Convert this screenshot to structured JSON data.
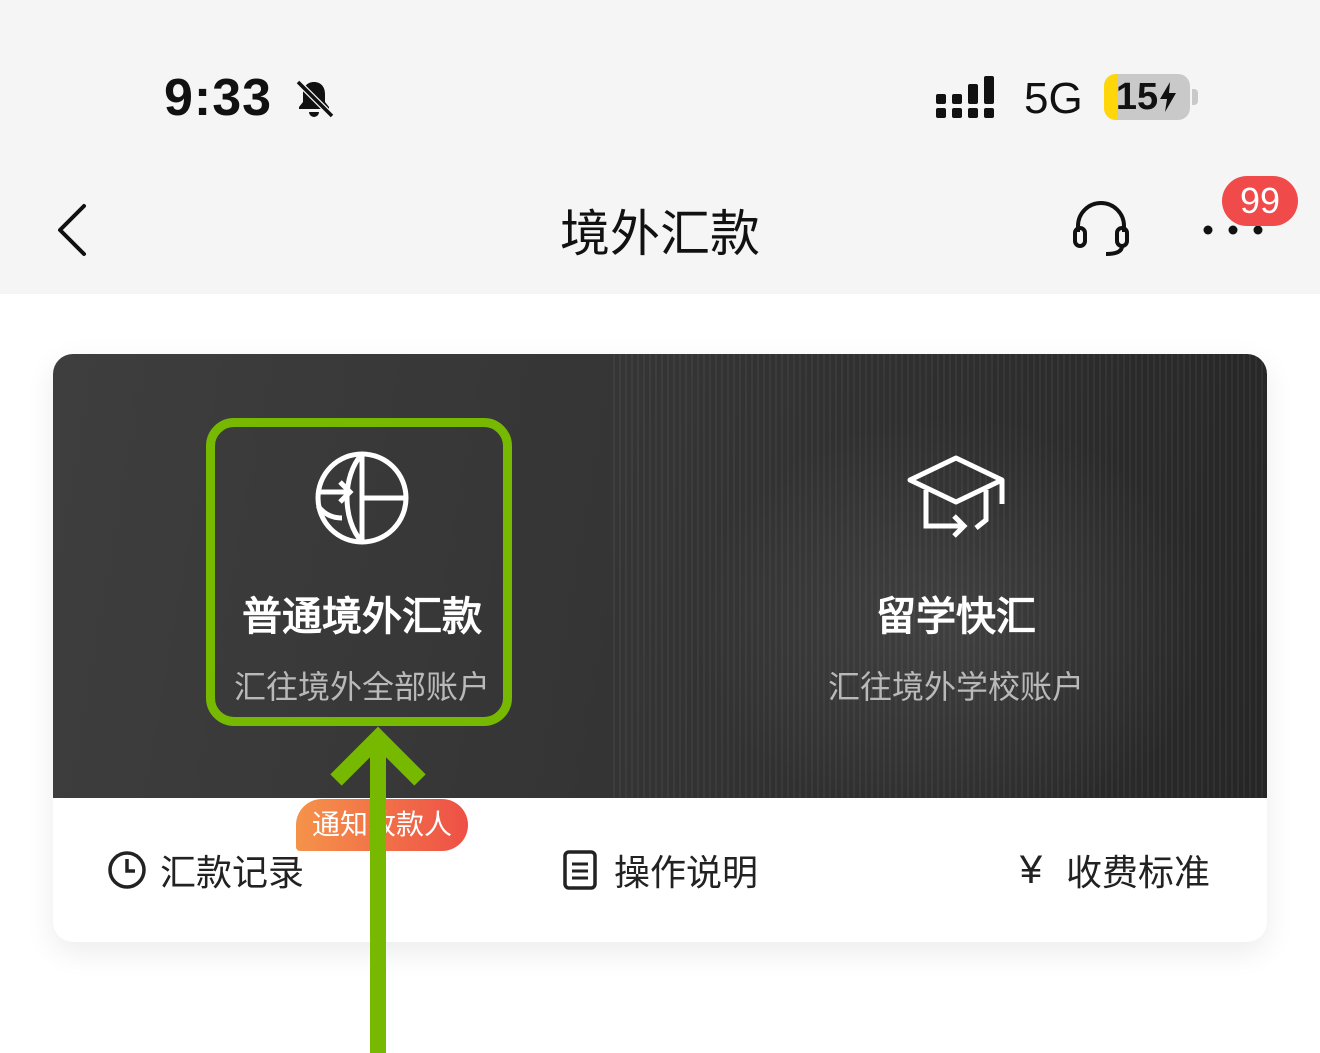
{
  "status_bar": {
    "time": "9:33",
    "network": "5G",
    "battery_level": "15",
    "battery_fraction": 0.15,
    "icons": [
      "bell-off-icon",
      "signal-icon",
      "battery-charging-icon"
    ]
  },
  "nav": {
    "title": "境外汇款",
    "badge_count": "99",
    "icons": [
      "chevron-left-icon",
      "headset-icon",
      "more-icon"
    ]
  },
  "options": [
    {
      "title": "普通境外汇款",
      "subtitle": "汇往境外全部账户",
      "icon": "globe-transfer-icon"
    },
    {
      "title": "留学快汇",
      "subtitle": "汇往境外学校账户",
      "icon": "graduation-cap-icon"
    }
  ],
  "tag": "通知收款人",
  "quick_links": [
    {
      "label": "汇款记录",
      "icon": "clock-icon"
    },
    {
      "label": "操作说明",
      "icon": "document-icon"
    },
    {
      "label": "收费标准",
      "icon": "yen-icon",
      "glyph": "¥"
    }
  ],
  "colors": {
    "highlight": "#76b900",
    "badge": "#f04a4a",
    "tag_start": "#f5934a",
    "tag_end": "#ee5046",
    "battery": "#ffd60a"
  }
}
